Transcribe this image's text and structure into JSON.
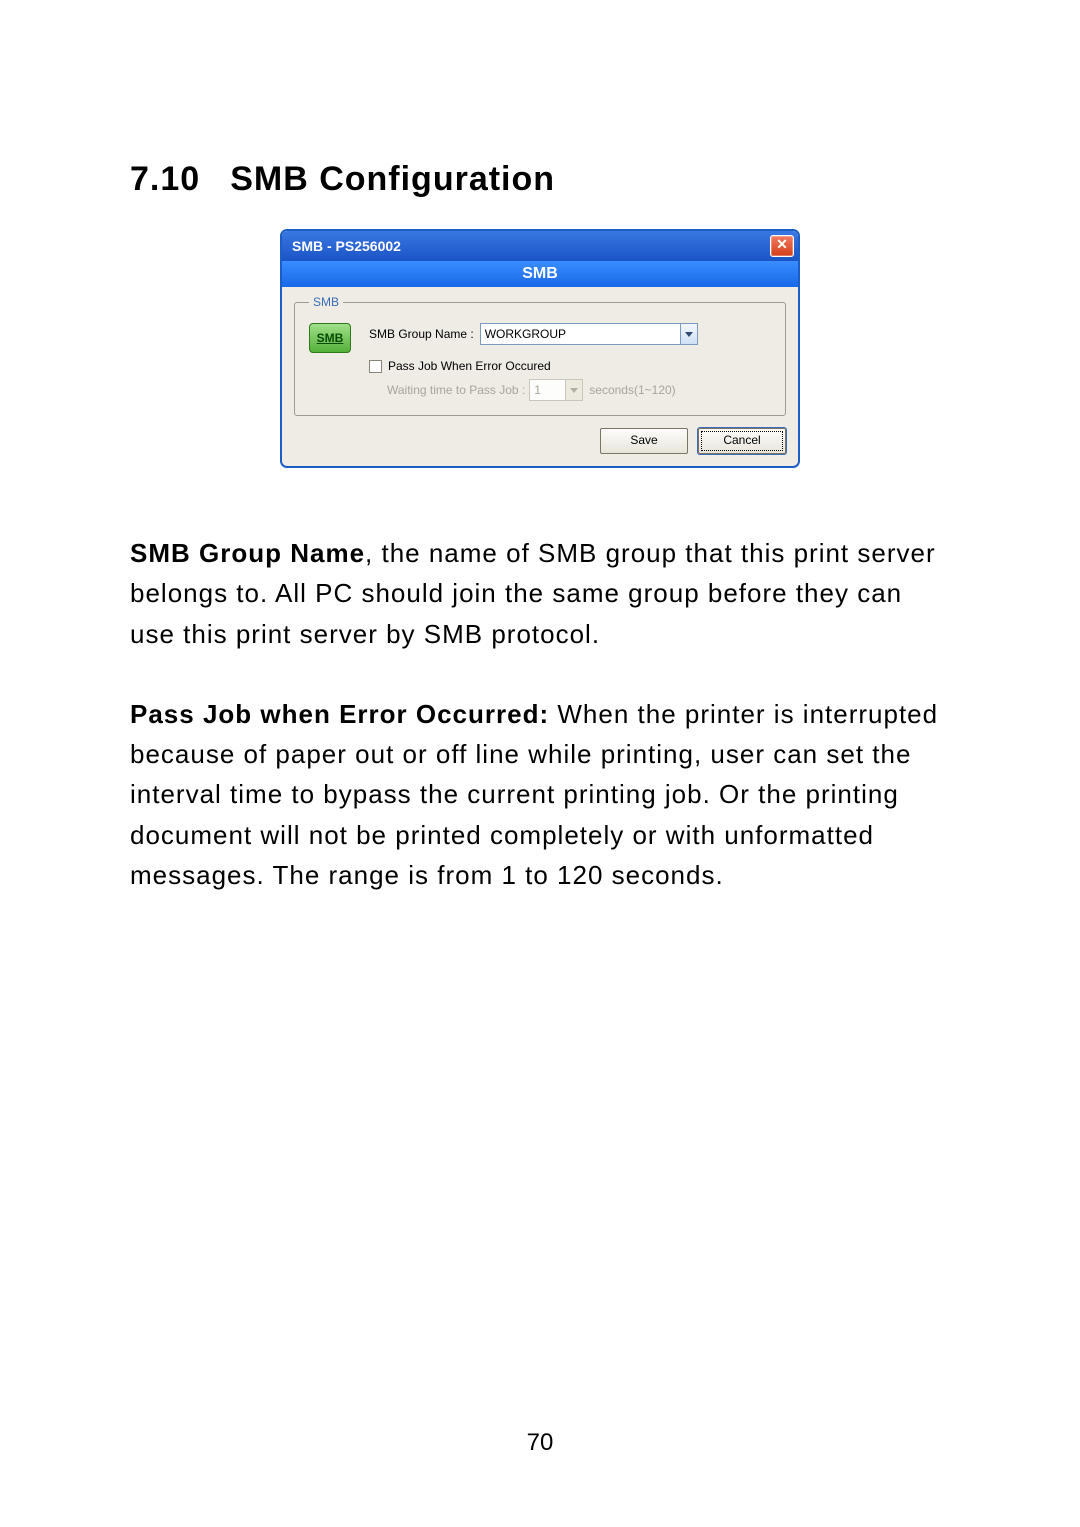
{
  "heading": {
    "number": "7.10",
    "title": "SMB Configuration"
  },
  "dialog": {
    "title": "SMB - PS256002",
    "close_glyph": "✕",
    "banner": "SMB",
    "fieldset_legend": "SMB",
    "smb_icon_label": "SMB",
    "group_name_label": "SMB Group Name :",
    "group_name_value": "WORKGROUP",
    "pass_job_label": "Pass Job When Error Occured",
    "waiting_label": "Waiting time to Pass Job :",
    "waiting_value": "1",
    "waiting_suffix": "seconds(1~120)",
    "save_label": "Save",
    "cancel_label": "Cancel"
  },
  "paragraphs": {
    "p1_bold": "SMB Group Name",
    "p1_rest": ", the name of SMB group that this print server belongs to. All PC should join the same group before they can use this print server by SMB protocol.",
    "p2_bold": "Pass Job when Error Occurred:",
    "p2_rest": " When the printer is interrupted because of paper out or off line while printing, user can set the interval time to bypass the current printing job. Or the printing document will not be printed completely or with unformatted messages. The range is from 1 to 120 seconds."
  },
  "page_number": "70"
}
